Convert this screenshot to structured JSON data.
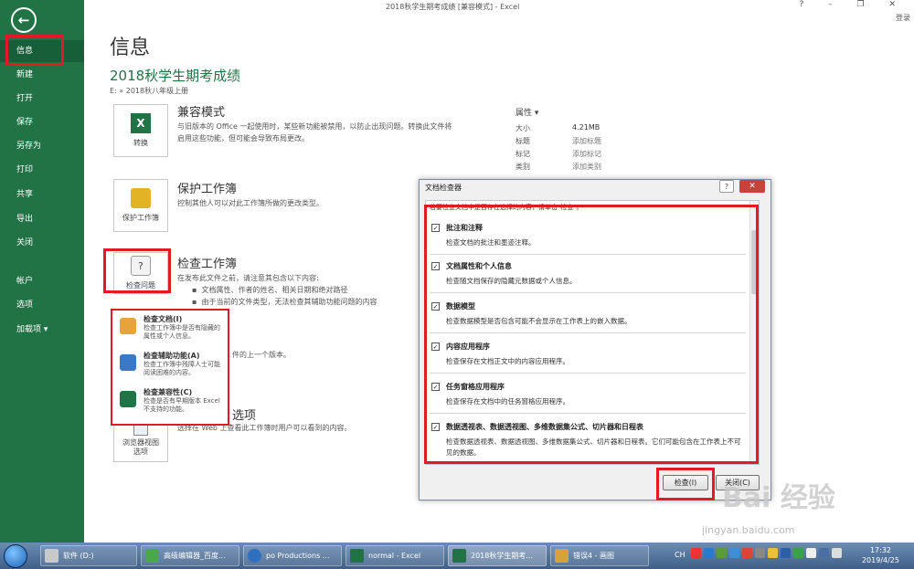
{
  "window": {
    "title": "2018秋学生期考成绩 [兼容模式] - Excel",
    "controls": "?  –  ❐  ✕",
    "login": "登录"
  },
  "sidebar": {
    "items": [
      {
        "label": "信息"
      },
      {
        "label": "新建"
      },
      {
        "label": "打开"
      },
      {
        "label": "保存"
      },
      {
        "label": "另存为"
      },
      {
        "label": "打印"
      },
      {
        "label": "共享"
      },
      {
        "label": "导出"
      },
      {
        "label": "关闭"
      },
      {
        "label": "帐户"
      },
      {
        "label": "选项"
      },
      {
        "label": "加载项 ▾"
      }
    ]
  },
  "main": {
    "title": "信息",
    "doc_name": "2018秋学生期考成绩",
    "path": "E: » 2018秋八年级上册",
    "compat": {
      "button": "转换",
      "title": "兼容模式",
      "desc": [
        "与旧版本的 Office 一起使用时，某些新功能被禁用，以防止出现问题。转换此文件将",
        "启用这些功能，但可能会导致布局更改。"
      ]
    },
    "protect": {
      "button": "保护工作簿",
      "title": "保护工作簿",
      "desc": "控制其他人可以对此工作簿所做的更改类型。"
    },
    "inspect": {
      "button": "检查问题",
      "title": "检查工作簿",
      "desc": "在发布此文件之前，请注意其包含以下内容:",
      "bullets": [
        "文档属性、作者的姓名、相关日期和绝对路径",
        "由于当前的文件类型，无法检查其辅助功能问题的内容"
      ],
      "fragment": "件的上一个版本。"
    },
    "browser": {
      "button": "浏览器视图\n选项",
      "title": "浏览器视图选项",
      "desc": "选择在 Web 上查看此工作簿时用户可以看到的内容。"
    },
    "properties": {
      "header": "属性 ▾",
      "rows": [
        {
          "key": "大小",
          "value": "4.21MB"
        },
        {
          "key": "标题",
          "value": "添加标题"
        },
        {
          "key": "标记",
          "value": "添加标记"
        },
        {
          "key": "类别",
          "value": "添加类别"
        }
      ]
    }
  },
  "dropdown": {
    "items": [
      {
        "title": "检查文档(I)",
        "desc": "检查工作簿中是否有隐藏的属性或个人信息。",
        "icon_color": "#e8a33a"
      },
      {
        "title": "检查辅助功能(A)",
        "desc": "检查工作簿中残障人士可能阅读困难的内容。",
        "icon_color": "#3a78c8"
      },
      {
        "title": "检查兼容性(C)",
        "desc": "检查是否有早期版本 Excel 不支持的功能。",
        "icon_color": "#217346"
      }
    ]
  },
  "dialog": {
    "title": "文档检查器",
    "help": "?",
    "close": "✕",
    "instruction": "若要检查文档中是否存在选择的内容，请单击\"检查\"。",
    "options": [
      {
        "title": "批注和注释",
        "desc": "检查文档的批注和墨迹注释。",
        "checked": "✓"
      },
      {
        "title": "文档属性和个人信息",
        "desc": "检查随文档保存的隐藏元数据或个人信息。",
        "checked": "✓"
      },
      {
        "title": "数据模型",
        "desc": "检查数据模型是否包含可能不会显示在工作表上的嵌入数据。",
        "checked": "✓"
      },
      {
        "title": "内容应用程序",
        "desc": "检查保存在文档正文中的内容应用程序。",
        "checked": "✓"
      },
      {
        "title": "任务窗格应用程序",
        "desc": "检查保存在文档中的任务窗格应用程序。",
        "checked": "✓"
      },
      {
        "title": "数据透视表、数据透视图、多维数据集公式、切片器和日程表",
        "desc": "检查数据透视表、数据透视图、多维数据集公式、切片器和日程表。它们可能包含在工作表上不可见的数据。",
        "checked": "✓"
      }
    ],
    "inspect_btn": "检查(I)",
    "close_btn": "关闭(C)"
  },
  "watermark": {
    "main": "Bai 经验",
    "sub": "jingyan.baidu.com"
  },
  "taskbar": {
    "items": [
      {
        "label": "软件 (D:)",
        "icon_color": "#c9c9c9"
      },
      {
        "label": "高级编辑器_百度...",
        "icon_color": "#4aa84a"
      },
      {
        "label": "po Productions ...",
        "icon_color": "#2f6fc0"
      },
      {
        "label": "normal - Excel",
        "icon_color": "#217346"
      },
      {
        "label": "2018秋学生期考...",
        "icon_color": "#217346"
      },
      {
        "label": "错误4 - 画图",
        "icon_color": "#d6a23a"
      }
    ],
    "tray_lang": "CH",
    "time": "17:32",
    "date": "2019/4/25"
  }
}
